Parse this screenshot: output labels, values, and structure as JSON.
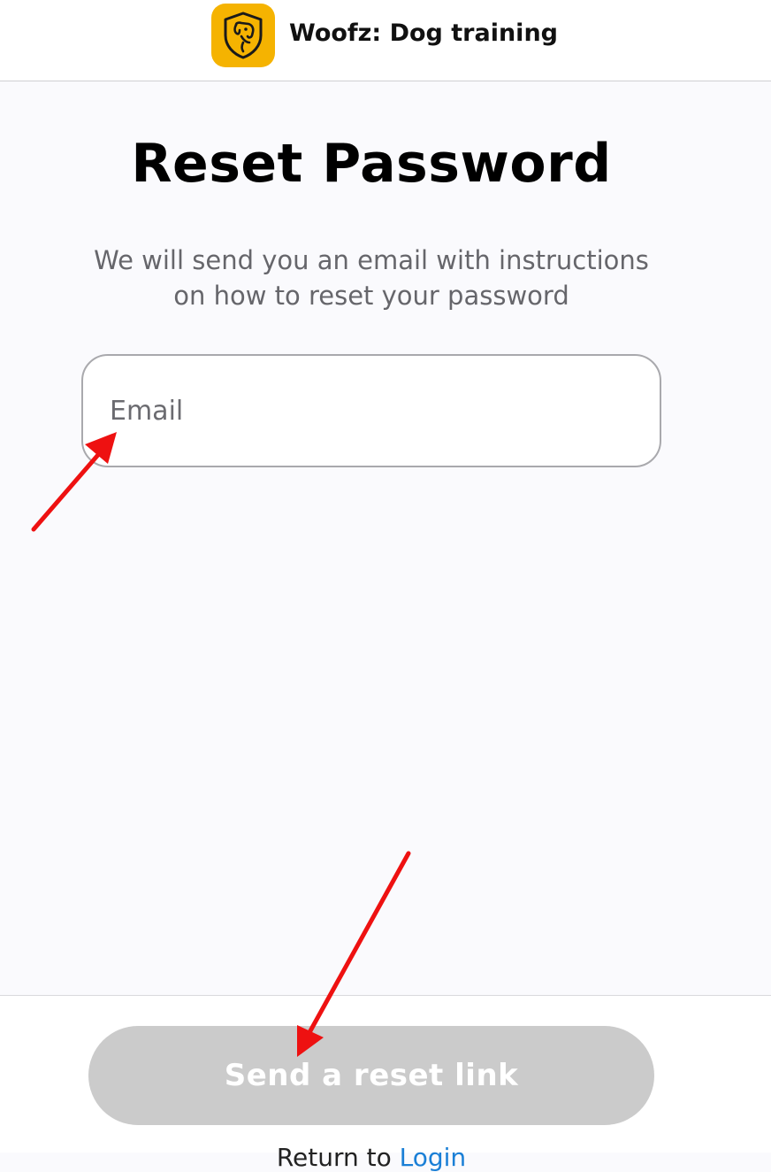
{
  "header": {
    "app_title": "Woofz: Dog training",
    "logo_icon": "dog-shield-icon",
    "logo_color": "#f5b301"
  },
  "main": {
    "title": "Reset Password",
    "subtitle": "We will send you an email with instructions on how to reset your password",
    "email_field": {
      "placeholder": "Email",
      "value": ""
    }
  },
  "footer": {
    "button_label": "Send a reset link",
    "button_color": "#cbcbcb",
    "return_prefix": "Return to ",
    "return_link": "Login"
  },
  "annotations": {
    "arrow_color": "#ee1111"
  }
}
